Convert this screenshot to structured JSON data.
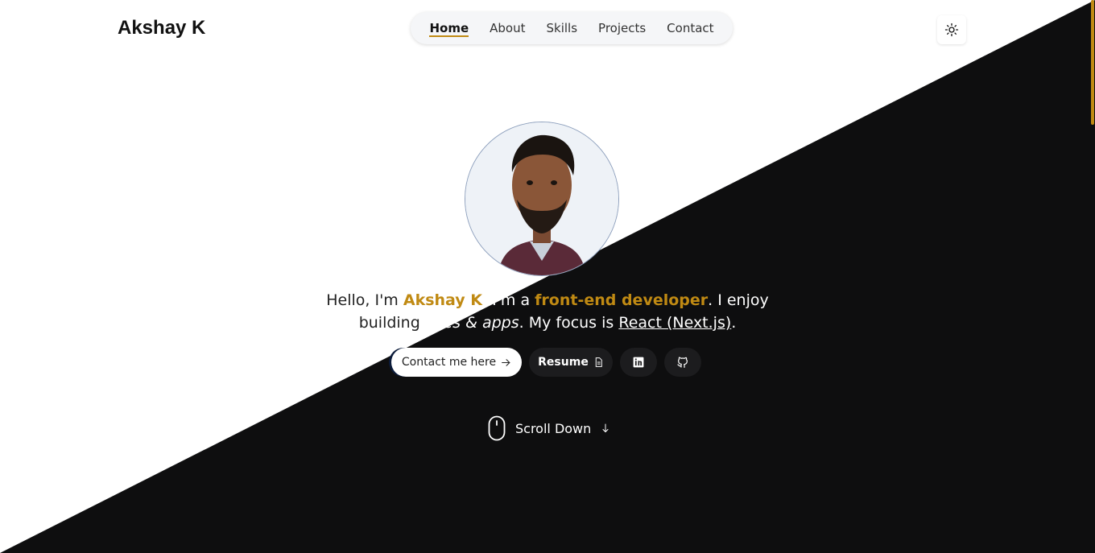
{
  "header": {
    "logo": "Akshay K",
    "nav": [
      {
        "label": "Home",
        "active": true
      },
      {
        "label": "About",
        "active": false
      },
      {
        "label": "Skills",
        "active": false
      },
      {
        "label": "Projects",
        "active": false
      },
      {
        "label": "Contact",
        "active": false
      }
    ],
    "theme_icon": "sun-icon"
  },
  "hero": {
    "avatar_icon": "profile-photo",
    "intro": {
      "hello": "Hello, I'm ",
      "name": "Akshay K",
      "after_name": ". I'm a ",
      "role": "front-end developer",
      "after_role": ". I enjoy",
      "building": "building ",
      "sites": "sites & apps",
      "focus": ". My focus is ",
      "tech": "React (Next.js)",
      "end": "."
    },
    "buttons": {
      "contact": "Contact me here",
      "contact_icon": "arrow-right-icon",
      "resume": "Resume",
      "resume_icon": "document-icon",
      "linkedin_icon": "linkedin-icon",
      "github_icon": "github-icon"
    },
    "scroll": {
      "label": "Scroll Down",
      "mouse_icon": "mouse-icon",
      "arrow_icon": "arrow-down-icon"
    }
  },
  "colors": {
    "accent": "#c08a13",
    "dark": "#0e0e0f",
    "light": "#ffffff"
  }
}
